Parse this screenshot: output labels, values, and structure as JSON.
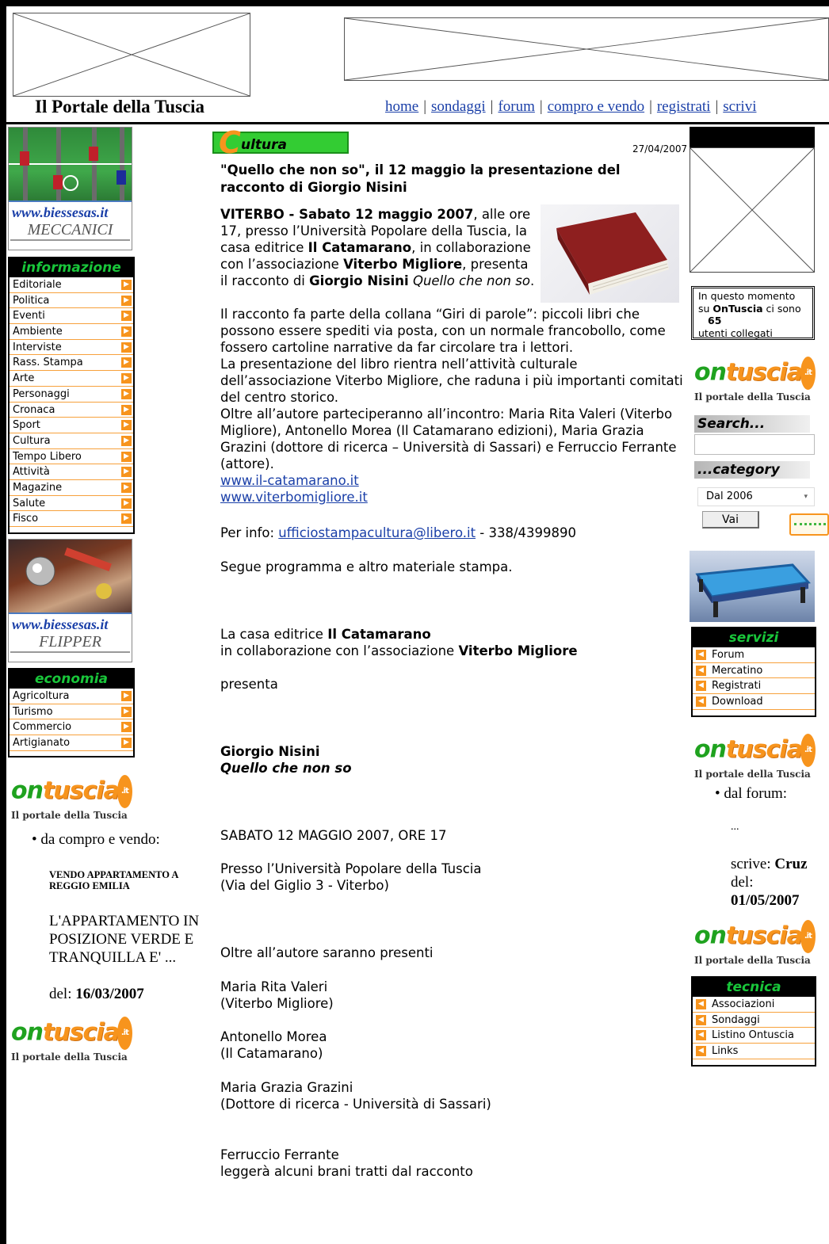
{
  "site": {
    "title": "Il Portale della Tuscia"
  },
  "nav": {
    "items": [
      "home",
      "sondaggi",
      "forum",
      "compro e vendo",
      "registrati",
      "scrivi"
    ],
    "separator": "|"
  },
  "left": {
    "banner_top": {
      "url": "www.biessesas.it",
      "word": "MECCANICI"
    },
    "info_menu": {
      "header": "informazione",
      "items": [
        "Editoriale",
        "Politica",
        "Eventi",
        "Ambiente",
        "Interviste",
        "Rass. Stampa",
        "Arte",
        "Personaggi",
        "Cronaca",
        "Sport",
        "Cultura",
        "Tempo Libero",
        "Attività",
        "Magazine",
        "Salute",
        "Fisco"
      ]
    },
    "banner_bottom": {
      "url": "www.biessesas.it",
      "word": "FLIPPER"
    },
    "eco_menu": {
      "header": "economia",
      "items": [
        "Agricoltura",
        "Turismo",
        "Commercio",
        "Artigianato"
      ]
    },
    "compro": {
      "bullet": "da compro e vendo:",
      "title": "VENDO APPARTAMENTO A REGGIO EMILIA",
      "body": "L'APPARTAMENTO IN POSIZIONE VERDE E TRANQUILLA E' ...",
      "date_label": "del:",
      "date": "16/03/2007"
    }
  },
  "logo": {
    "on": "on",
    "tuscia": "tuscia",
    "it": ".it",
    "tagline": "Il portale della Tuscia"
  },
  "article": {
    "category_letter": "C",
    "category_rest": "ultura",
    "date": "27/04/2007",
    "headline": "\"Quello che non so\", il 12 maggio la presentazione del racconto di Giorgio Nisini",
    "p1_bold1": "VITERBO - Sabato 12 maggio 2007",
    "p1_t1": ", alle ore 17, presso l’Università Popolare della Tuscia, la casa editrice ",
    "p1_bold2": "Il Catamarano",
    "p1_t2": ", in collaborazione con l’associazione ",
    "p1_bold3": "Viterbo Migliore",
    "p1_t3": ", presenta il racconto di ",
    "p1_bold4": "Giorgio Nisini",
    "p1_t4": " ",
    "p1_italic": "Quello che non so",
    "p1_t5": ".",
    "p2": "Il racconto fa parte della collana “Giri di parole”: piccoli libri che possono essere spediti via posta, con un normale francobollo, come fossero cartoline narrative da far circolare tra i lettori.",
    "p3": "La presentazione del libro rientra nell’attività culturale dell’associazione Viterbo Migliore, che raduna i più importanti comitati del centro storico.",
    "p4": "Oltre all’autore parteciperanno all’incontro: Maria Rita Valeri (Viterbo Migliore), Antonello Morea (Il Catamarano edizioni), Maria Grazia Grazini (dottore di ricerca – Università di Sassari) e Ferruccio Ferrante (attore).",
    "link1": "www.il-catamarano.it",
    "link2": "www.viterbomigliore.it",
    "info_label": "Per info: ",
    "info_email": "ufficiostampacultura@libero.it",
    "info_phone": " - 338/4399890",
    "segue": "Segue programma e altro materiale stampa.",
    "casa_t1": "La casa editrice ",
    "casa_b1": "Il Catamarano",
    "casa_t2": "in collaborazione con l’associazione ",
    "casa_b2": "Viterbo Migliore",
    "presenta": "presenta",
    "author": "Giorgio Nisini",
    "book": "Quello che non so",
    "when": "SABATO 12 MAGGIO 2007, ORE 17",
    "where1": "Presso l’Università Popolare della Tuscia",
    "where2": "(Via del Giglio 3 - Viterbo)",
    "oltre": "Oltre all’autore saranno presenti",
    "g1a": "Maria Rita Valeri",
    "g1b": "(Viterbo Migliore)",
    "g2a": "Antonello Morea",
    "g2b": "(Il Catamarano)",
    "g3a": "Maria Grazia Grazini",
    "g3b": "(Dottore di ricerca - Università di Sassari)",
    "g4a": "Ferruccio Ferrante",
    "g4b": "leggerà alcuni brani tratti dal racconto"
  },
  "right": {
    "online": {
      "t1": "In questo momento",
      "t2a": "su ",
      "t2b": "OnTuscia",
      "t2c": " ci sono",
      "count": "65",
      "t3": "utenti collegati"
    },
    "search_label": "Search...",
    "category_label": "...category",
    "select_value": "Dal 2006",
    "vai": "Vai",
    "servizi": {
      "header": "servizi",
      "items": [
        "Forum",
        "Mercatino",
        "Registrati",
        "Download"
      ]
    },
    "forum": {
      "bullet": "dal forum:",
      "text": "...",
      "scrive_label": "scrive:",
      "author": "Cruz",
      "del_label": "del:",
      "date": "01/05/2007"
    },
    "tecnica": {
      "header": "tecnica",
      "items": [
        "Associazioni",
        "Sondaggi",
        "Listino Ontuscia",
        "Links"
      ]
    }
  }
}
